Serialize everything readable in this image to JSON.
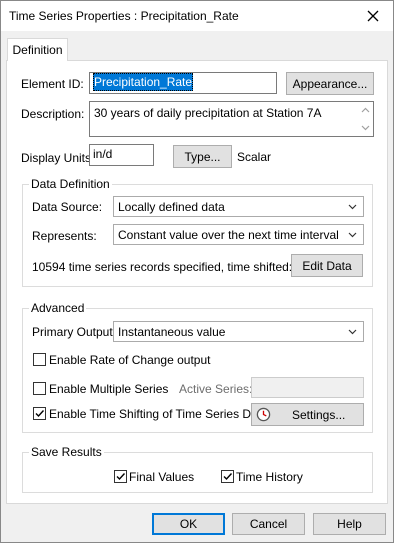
{
  "window": {
    "title": "Time Series Properties : Precipitation_Rate"
  },
  "tabs": [
    {
      "label": "Definition"
    }
  ],
  "element_id": {
    "label": "Element ID:",
    "value": "Precipitation_Rate",
    "appearance_button": "Appearance..."
  },
  "description": {
    "label": "Description:",
    "value": "30 years of daily precipitation at Station 7A"
  },
  "display_units": {
    "label": "Display Units:",
    "value": "in/d",
    "type_button": "Type...",
    "type_value": "Scalar"
  },
  "data_definition": {
    "title": "Data Definition",
    "data_source_label": "Data Source:",
    "data_source_value": "Locally defined data",
    "represents_label": "Represents:",
    "represents_value": "Constant value over the next time interval",
    "records_text": "10594 time series records specified, time shifted:",
    "edit_data_button": "Edit Data"
  },
  "advanced": {
    "title": "Advanced",
    "primary_output_label": "Primary Output:",
    "primary_output_value": "Instantaneous value",
    "rate_of_change_label": "Enable Rate of Change output",
    "rate_of_change_checked": false,
    "multiple_series_label": "Enable Multiple Series",
    "multiple_series_checked": false,
    "active_series_label": "Active Series:",
    "time_shifting_label": "Enable Time Shifting of Time Series Data",
    "time_shifting_checked": true,
    "settings_button": "Settings..."
  },
  "save_results": {
    "title": "Save Results",
    "final_values_label": "Final Values",
    "final_values_checked": true,
    "time_history_label": "Time History",
    "time_history_checked": true
  },
  "footer": {
    "ok": "OK",
    "cancel": "Cancel",
    "help": "Help"
  }
}
